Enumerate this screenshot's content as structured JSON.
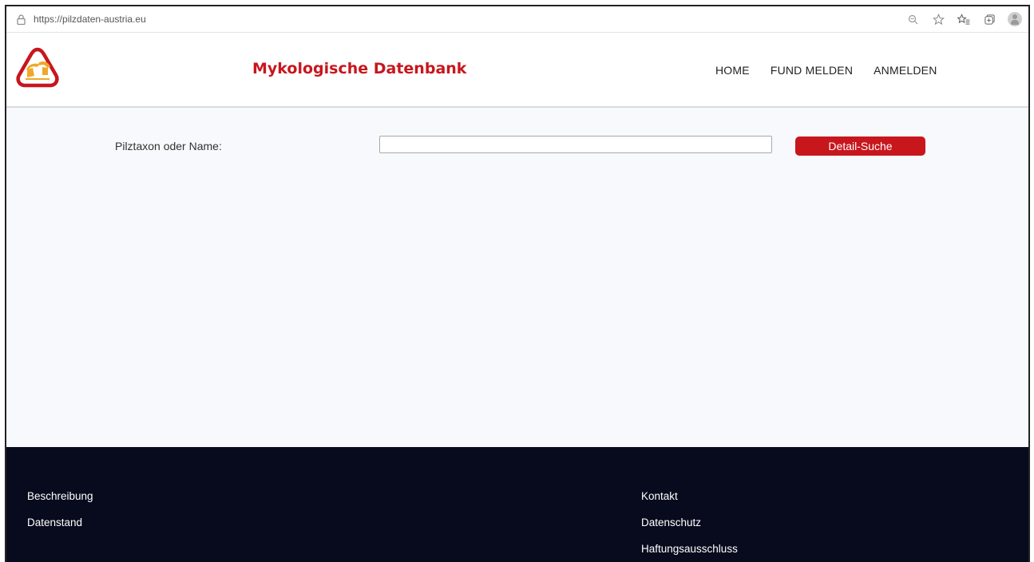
{
  "browser": {
    "url": "https://pilzdaten-austria.eu",
    "icons": [
      "zoom-icon",
      "favorite-star-icon",
      "favorites-list-icon",
      "collections-icon",
      "profile-icon"
    ]
  },
  "header": {
    "title": "Mykologische Datenbank",
    "brand_color": "#c8161d",
    "nav": [
      "HOME",
      "FUND MELDEN",
      "ANMELDEN"
    ]
  },
  "search": {
    "label": "Pilztaxon oder Name:",
    "value": "",
    "placeholder": "",
    "button_label": "Detail-Suche"
  },
  "footer": {
    "background": "#080b1e",
    "left_links": [
      "Beschreibung",
      "Datenstand"
    ],
    "right_links": [
      "Kontakt",
      "Datenschutz",
      "Haftungsausschluss"
    ]
  }
}
